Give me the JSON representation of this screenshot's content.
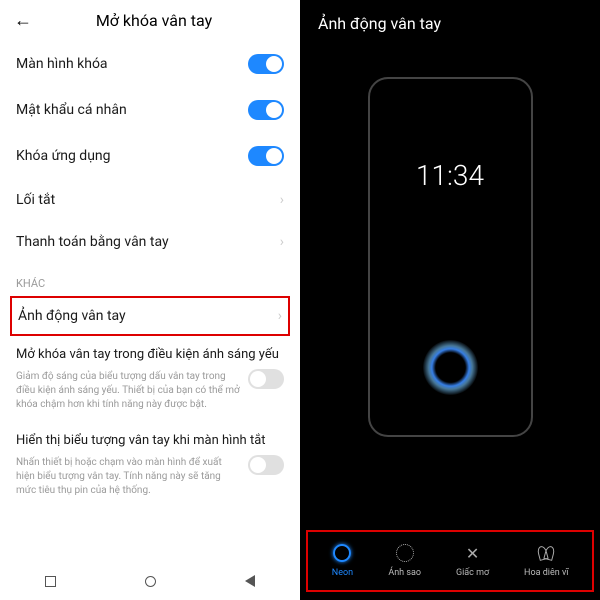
{
  "left": {
    "title": "Mở khóa vân tay",
    "rows": {
      "lock_screen": "Màn hình khóa",
      "password": "Mật khẩu cá nhân",
      "app_lock": "Khóa ứng dụng",
      "shortcut": "Lối tắt",
      "payment": "Thanh toán bằng vân tay"
    },
    "section_other": "KHÁC",
    "animation": "Ảnh động vân tay",
    "lowlight_title": "Mở khóa vân tay trong điều kiện ánh sáng yếu",
    "lowlight_desc": "Giảm độ sáng của biểu tượng dấu vân tay trong điều kiện ánh sáng yếu. Thiết bị của bạn có thể mở khóa chậm hơn khi tính năng này được bật.",
    "showicon_title": "Hiển thị biểu tượng vân tay khi màn hình tắt",
    "showicon_desc": "Nhấn thiết bị hoặc chạm vào màn hình để xuất hiện biểu tượng vân tay. Tính năng này sẽ tăng mức tiêu thụ pin của hệ thống."
  },
  "right": {
    "title": "Ảnh động vân tay",
    "clock": "11:34",
    "styles": {
      "neon": "Neon",
      "starlight": "Ánh sao",
      "dream": "Giấc mơ",
      "butterfly": "Hoa diên vĩ"
    }
  }
}
